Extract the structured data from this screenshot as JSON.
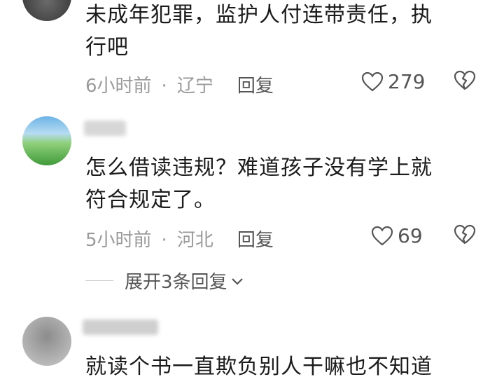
{
  "comments": [
    {
      "text_lines": [
        "未成年犯罪，监护人付连带责任，执",
        "行吧"
      ],
      "time": "6小时前",
      "location": "辽宁",
      "reply_label": "回复",
      "likes": "279"
    },
    {
      "text_lines": [
        "怎么借读违规？难道孩子没有学上就",
        "符合规定了。"
      ],
      "time": "5小时前",
      "location": "河北",
      "reply_label": "回复",
      "likes": "69"
    },
    {
      "text_lines": [
        "就读个书一直欺负别人干嘛也不知道"
      ]
    }
  ],
  "expand_replies": "展开3条回复",
  "meta_separator": "·",
  "icons": {
    "like": "heart-icon",
    "dislike": "broken-heart-icon",
    "expand": "chevron-down-icon"
  }
}
